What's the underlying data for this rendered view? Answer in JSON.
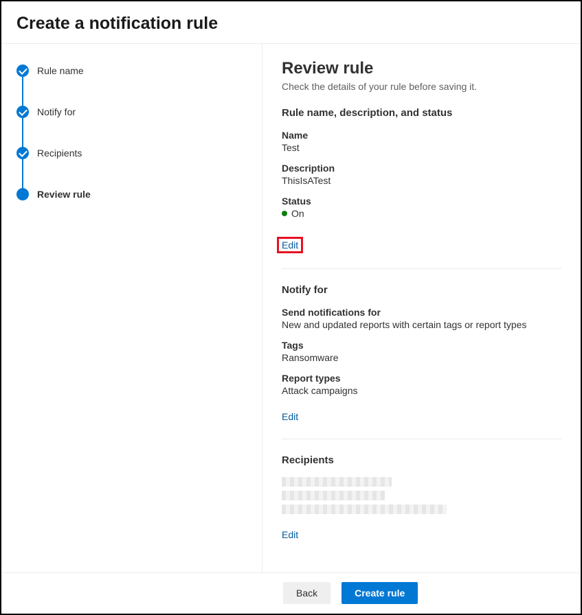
{
  "header": {
    "title": "Create a notification rule"
  },
  "steps": [
    {
      "label": "Rule name",
      "state": "done"
    },
    {
      "label": "Notify for",
      "state": "done"
    },
    {
      "label": "Recipients",
      "state": "done"
    },
    {
      "label": "Review rule",
      "state": "current"
    }
  ],
  "review": {
    "title": "Review rule",
    "subtitle": "Check the details of your rule before saving it.",
    "section1": {
      "heading": "Rule name, description, and status",
      "name_label": "Name",
      "name_value": "Test",
      "description_label": "Description",
      "description_value": "ThisIsATest",
      "status_label": "Status",
      "status_value": "On",
      "edit_label": "Edit"
    },
    "section2": {
      "heading": "Notify for",
      "send_label": "Send notifications for",
      "send_value": "New and updated reports with certain tags or report types",
      "tags_label": "Tags",
      "tags_value": "Ransomware",
      "types_label": "Report types",
      "types_value": "Attack campaigns",
      "edit_label": "Edit"
    },
    "section3": {
      "heading": "Recipients",
      "edit_label": "Edit"
    }
  },
  "footer": {
    "back_label": "Back",
    "create_label": "Create rule"
  }
}
